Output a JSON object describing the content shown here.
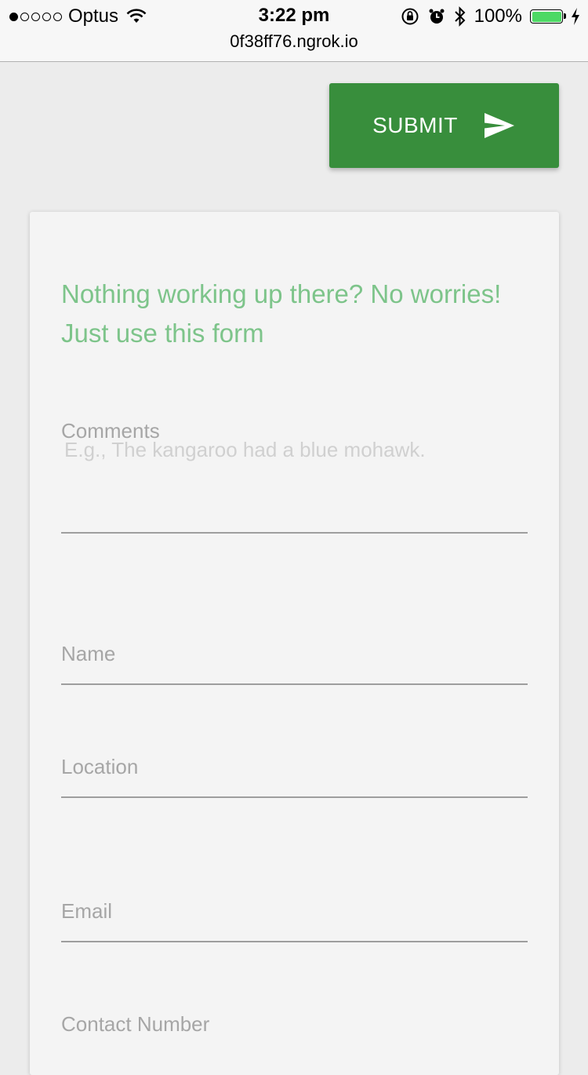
{
  "status_bar": {
    "carrier": "Optus",
    "time": "3:22 pm",
    "url": "0f38ff76.ngrok.io",
    "battery": "100%",
    "signal_strength": 1,
    "battery_color": "#4cd964"
  },
  "toolbar": {
    "submit_label": "SUBMIT",
    "submit_color": "#388e3c"
  },
  "form": {
    "heading": "Nothing working up there? No worries! Just use this form",
    "heading_color": "#7dc48a",
    "comments": {
      "label": "Comments",
      "placeholder": "E.g., The kangaroo had a blue mohawk.",
      "value": ""
    },
    "name": {
      "label": "Name",
      "value": ""
    },
    "location": {
      "label": "Location",
      "value": ""
    },
    "email": {
      "label": "Email",
      "value": ""
    },
    "contact_number": {
      "label": "Contact Number",
      "value": ""
    }
  }
}
